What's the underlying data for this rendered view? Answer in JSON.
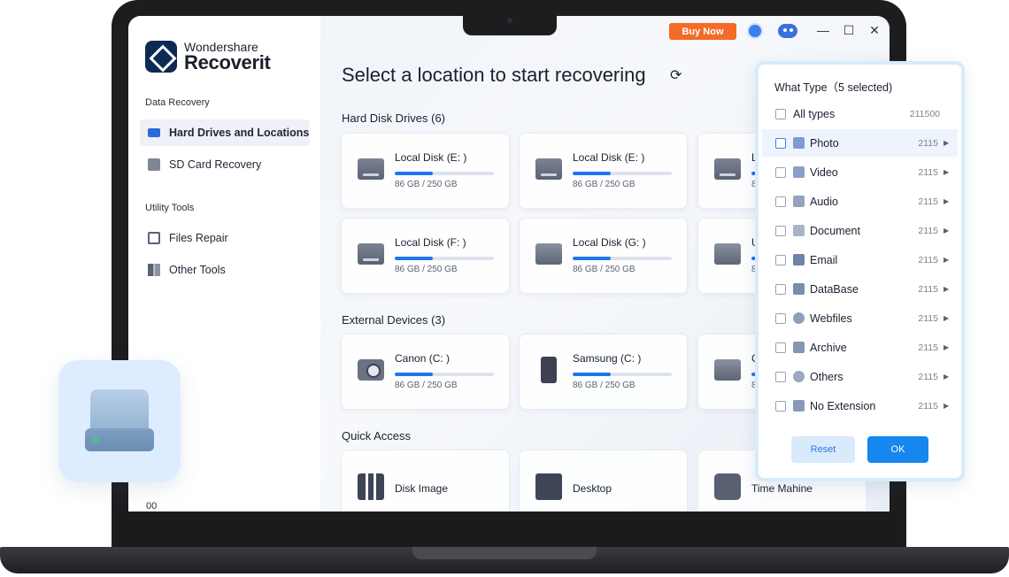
{
  "app": {
    "brand": "Wondershare",
    "name": "Recoverit"
  },
  "topbar": {
    "buy_label": "Buy Now",
    "minimize": "—",
    "maximize": "☐",
    "close": "✕"
  },
  "sidebar": {
    "section_data_recovery": "Data Recovery",
    "section_utility": "Utility Tools",
    "items": [
      {
        "label": "Hard Drives and Locations",
        "icon": "hard-drive-icon"
      },
      {
        "label": "SD Card Recovery",
        "icon": "sd-card-icon"
      },
      {
        "label": "Files Repair",
        "icon": "files-repair-icon"
      },
      {
        "label": "Other Tools",
        "icon": "other-tools-icon"
      }
    ],
    "footer": "00"
  },
  "main": {
    "title": "Select a location to start recovering",
    "refresh_icon": "⟳",
    "hard_disk_title": "Hard Disk Drives (6)",
    "hard_disks": [
      {
        "name": "Local Disk (E: )",
        "size": "86 GB / 250 GB",
        "usage": 0.38
      },
      {
        "name": "Local Disk (E: )",
        "size": "86 GB / 250 GB",
        "usage": 0.38
      },
      {
        "name": "L",
        "size": "8",
        "usage": 0.38
      },
      {
        "name": "Local Disk (F: )",
        "size": "86 GB / 250 GB",
        "usage": 0.38
      },
      {
        "name": "Local Disk (G: )",
        "size": "86 GB / 250 GB",
        "usage": 0.38
      },
      {
        "name": "U",
        "size": "8",
        "usage": 0.38
      }
    ],
    "external_title": "External Devices (3)",
    "external": [
      {
        "name": "Canon (C: )",
        "size": "86 GB / 250 GB",
        "usage": 0.38
      },
      {
        "name": "Samsung (C: )",
        "size": "86 GB / 250 GB",
        "usage": 0.38
      },
      {
        "name": "C",
        "size": "8",
        "usage": 0.38
      }
    ],
    "quick_title": "Quick Access",
    "quick": [
      {
        "label": "Disk Image"
      },
      {
        "label": "Desktop"
      },
      {
        "label": "Time Mahine"
      }
    ]
  },
  "popup": {
    "title": "What Type（5 selected)",
    "types": [
      {
        "label": "All types",
        "count": "211500",
        "icon": "",
        "arrow": ""
      },
      {
        "label": "Photo",
        "count": "2115",
        "icon": "photo-icon",
        "arrow": "▶"
      },
      {
        "label": "Video",
        "count": "2115",
        "icon": "video-icon",
        "arrow": "▶"
      },
      {
        "label": "Audio",
        "count": "2115",
        "icon": "audio-icon",
        "arrow": "▶"
      },
      {
        "label": "Document",
        "count": "2115",
        "icon": "document-icon",
        "arrow": "▶"
      },
      {
        "label": "Email",
        "count": "2115",
        "icon": "email-icon",
        "arrow": "▶"
      },
      {
        "label": "DataBase",
        "count": "2115",
        "icon": "database-icon",
        "arrow": "▶"
      },
      {
        "label": "Webfiles",
        "count": "2115",
        "icon": "webfiles-icon",
        "arrow": "▶"
      },
      {
        "label": "Archive",
        "count": "2115",
        "icon": "archive-icon",
        "arrow": "▶"
      },
      {
        "label": "Others",
        "count": "2115",
        "icon": "others-icon",
        "arrow": "▶"
      },
      {
        "label": "No Extension",
        "count": "2115",
        "icon": "no-extension-icon",
        "arrow": "▶"
      }
    ],
    "reset_label": "Reset",
    "ok_label": "OK"
  },
  "colors": {
    "accent": "#1687ef",
    "buy": "#f36b26",
    "progress": "#1f74f0"
  }
}
